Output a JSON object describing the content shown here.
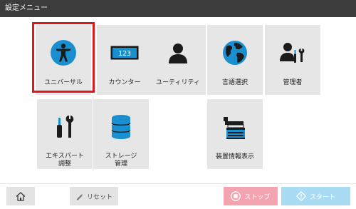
{
  "window": {
    "title": "設定メニュー"
  },
  "tiles": [
    {
      "id": "universal",
      "label": "ユニバーサル",
      "icon": "accessibility-icon",
      "selected": true
    },
    {
      "id": "counter",
      "label": "カウンター",
      "icon": "counter-icon",
      "counter_text": "123"
    },
    {
      "id": "utility",
      "label": "ユーティリティ",
      "icon": "user-icon"
    },
    {
      "id": "language",
      "label": "言語選択",
      "icon": "globe-icon"
    },
    {
      "id": "admin",
      "label": "管理者",
      "icon": "admin-tools-icon"
    },
    {
      "id": "expert",
      "label_line1": "エキスパート",
      "label_line2": "調整",
      "icon": "tools-icon"
    },
    {
      "id": "storage",
      "label_line1": "ストレージ",
      "label_line2": "管理",
      "icon": "database-icon"
    },
    {
      "id": "device-info",
      "label": "装置情報表示",
      "icon": "copier-icon"
    }
  ],
  "bottom": {
    "home": {
      "icon": "home-icon"
    },
    "reset": {
      "label": "リセット",
      "icon": "eraser-icon"
    },
    "stop": {
      "label": "ストップ",
      "icon": "stop-icon"
    },
    "start": {
      "label": "スタート",
      "icon": "start-icon"
    }
  },
  "colors": {
    "titlebar": "#3c3c3c",
    "tile": "#e6e6e6",
    "accent_blue": "#1a8fd0",
    "selection": "#e0161a",
    "stop": "#f4a3b1",
    "start": "#a9dcf2"
  }
}
